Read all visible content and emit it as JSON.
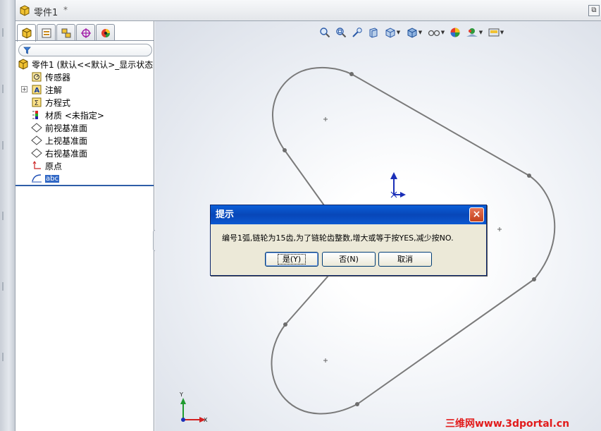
{
  "window": {
    "title": "零件1",
    "modified_marker": "*",
    "restore_label": "⧉"
  },
  "panel": {
    "tabs": [
      {
        "name": "feature-manager",
        "icon": "part-tree-icon"
      },
      {
        "name": "property-manager",
        "icon": "property-icon"
      },
      {
        "name": "configuration-manager",
        "icon": "configuration-icon"
      },
      {
        "name": "dimxpert-manager",
        "icon": "crosshair-icon"
      },
      {
        "name": "display-manager",
        "icon": "appearance-icon"
      }
    ],
    "filter_icon": "funnel-icon",
    "tree": {
      "root": "零件1  (默认<<默认>_显示状态",
      "items": [
        {
          "label": "传感器",
          "icon": "sensor-icon"
        },
        {
          "label": "注解",
          "icon": "annotation-icon",
          "expander": "+"
        },
        {
          "label": "方程式",
          "icon": "equation-icon"
        },
        {
          "label": "材质 <未指定>",
          "icon": "material-icon"
        },
        {
          "label": "前视基准面",
          "icon": "plane-icon"
        },
        {
          "label": "上视基准面",
          "icon": "plane-icon"
        },
        {
          "label": "右视基准面",
          "icon": "plane-icon"
        },
        {
          "label": "原点",
          "icon": "origin-icon"
        },
        {
          "label": "abc",
          "icon": "sketch-icon",
          "selected": true
        }
      ]
    }
  },
  "view_toolbar": [
    {
      "name": "zoom-to-fit",
      "icon": "zoom-fit-icon"
    },
    {
      "name": "zoom-to-area",
      "icon": "zoom-area-icon"
    },
    {
      "name": "previous-view",
      "icon": "previous-view-icon"
    },
    {
      "name": "section-view",
      "icon": "section-view-icon"
    },
    {
      "name": "view-orientation",
      "icon": "view-orientation-icon",
      "dropdown": true
    },
    {
      "name": "display-style",
      "icon": "display-style-icon",
      "dropdown": true
    },
    {
      "name": "hide-show",
      "icon": "hide-show-icon",
      "dropdown": true
    },
    {
      "name": "edit-appearance",
      "icon": "appearance-icon"
    },
    {
      "name": "apply-scene",
      "icon": "scene-icon",
      "dropdown": true
    },
    {
      "name": "view-settings",
      "icon": "view-settings-icon",
      "dropdown": true
    }
  ],
  "dialog": {
    "title": "提示",
    "close_label": "×",
    "message": "编号1弧,链轮为15齿,为了链轮齿整数,增大或等于按YES,减少按NO.",
    "buttons": {
      "yes": "是(Y)",
      "no": "否(N)",
      "cancel": "取消"
    }
  },
  "triad": {
    "y_label": "Y",
    "x_label": "X"
  },
  "watermark": "三维网www.3dportal.cn",
  "colors": {
    "accent": "#0a5fd8",
    "selection": "#3168c6",
    "sketch": "#7a7a7a",
    "watermark": "#e21b1b"
  }
}
